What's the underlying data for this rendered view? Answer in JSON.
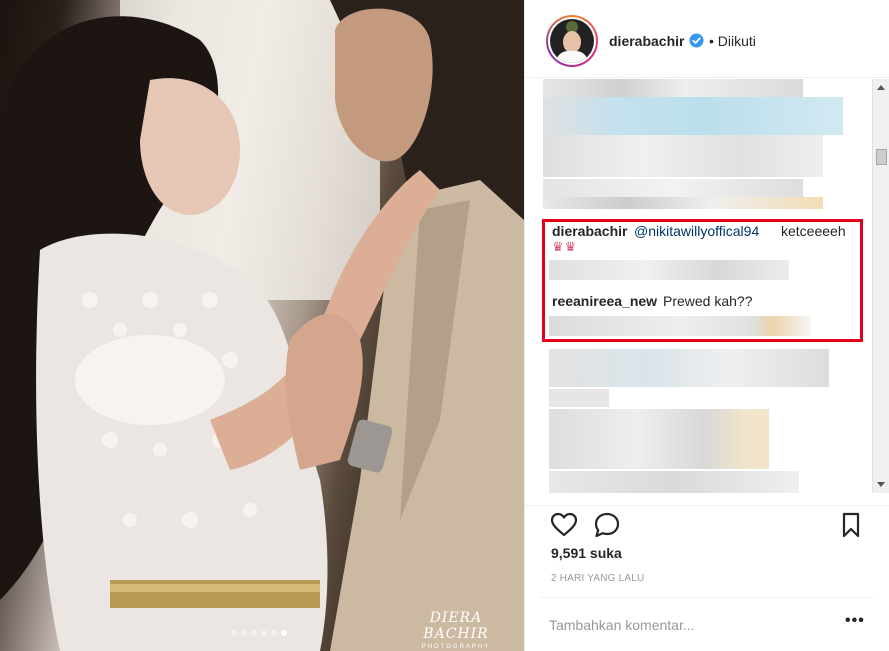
{
  "photo": {
    "watermark_main": "DIERA BACHIR",
    "watermark_sub": "PHOTOGRAPHY",
    "carousel_count": 6,
    "carousel_active_index": 5
  },
  "header": {
    "username": "dierabachir",
    "verified_icon": "verified-badge-icon",
    "follow_status": "• Diikuti"
  },
  "comments": [
    {
      "user": "dierabachir",
      "mention": "@nikitawillyoffical94",
      "text": "ketceeeeh"
    },
    {
      "user": "reeanireea_new",
      "text": "Prewed kah??"
    }
  ],
  "actions": {
    "like_icon": "heart-icon",
    "comment_icon": "comment-bubble-icon",
    "save_icon": "bookmark-icon"
  },
  "likes": "9,591 suka",
  "timestamp": "2 HARI YANG LALU",
  "comment_box": {
    "placeholder": "Tambahkan komentar...",
    "more_label": "•••"
  },
  "colors": {
    "highlight": "#e3001b",
    "verified": "#3897f0",
    "mention": "#003569"
  }
}
